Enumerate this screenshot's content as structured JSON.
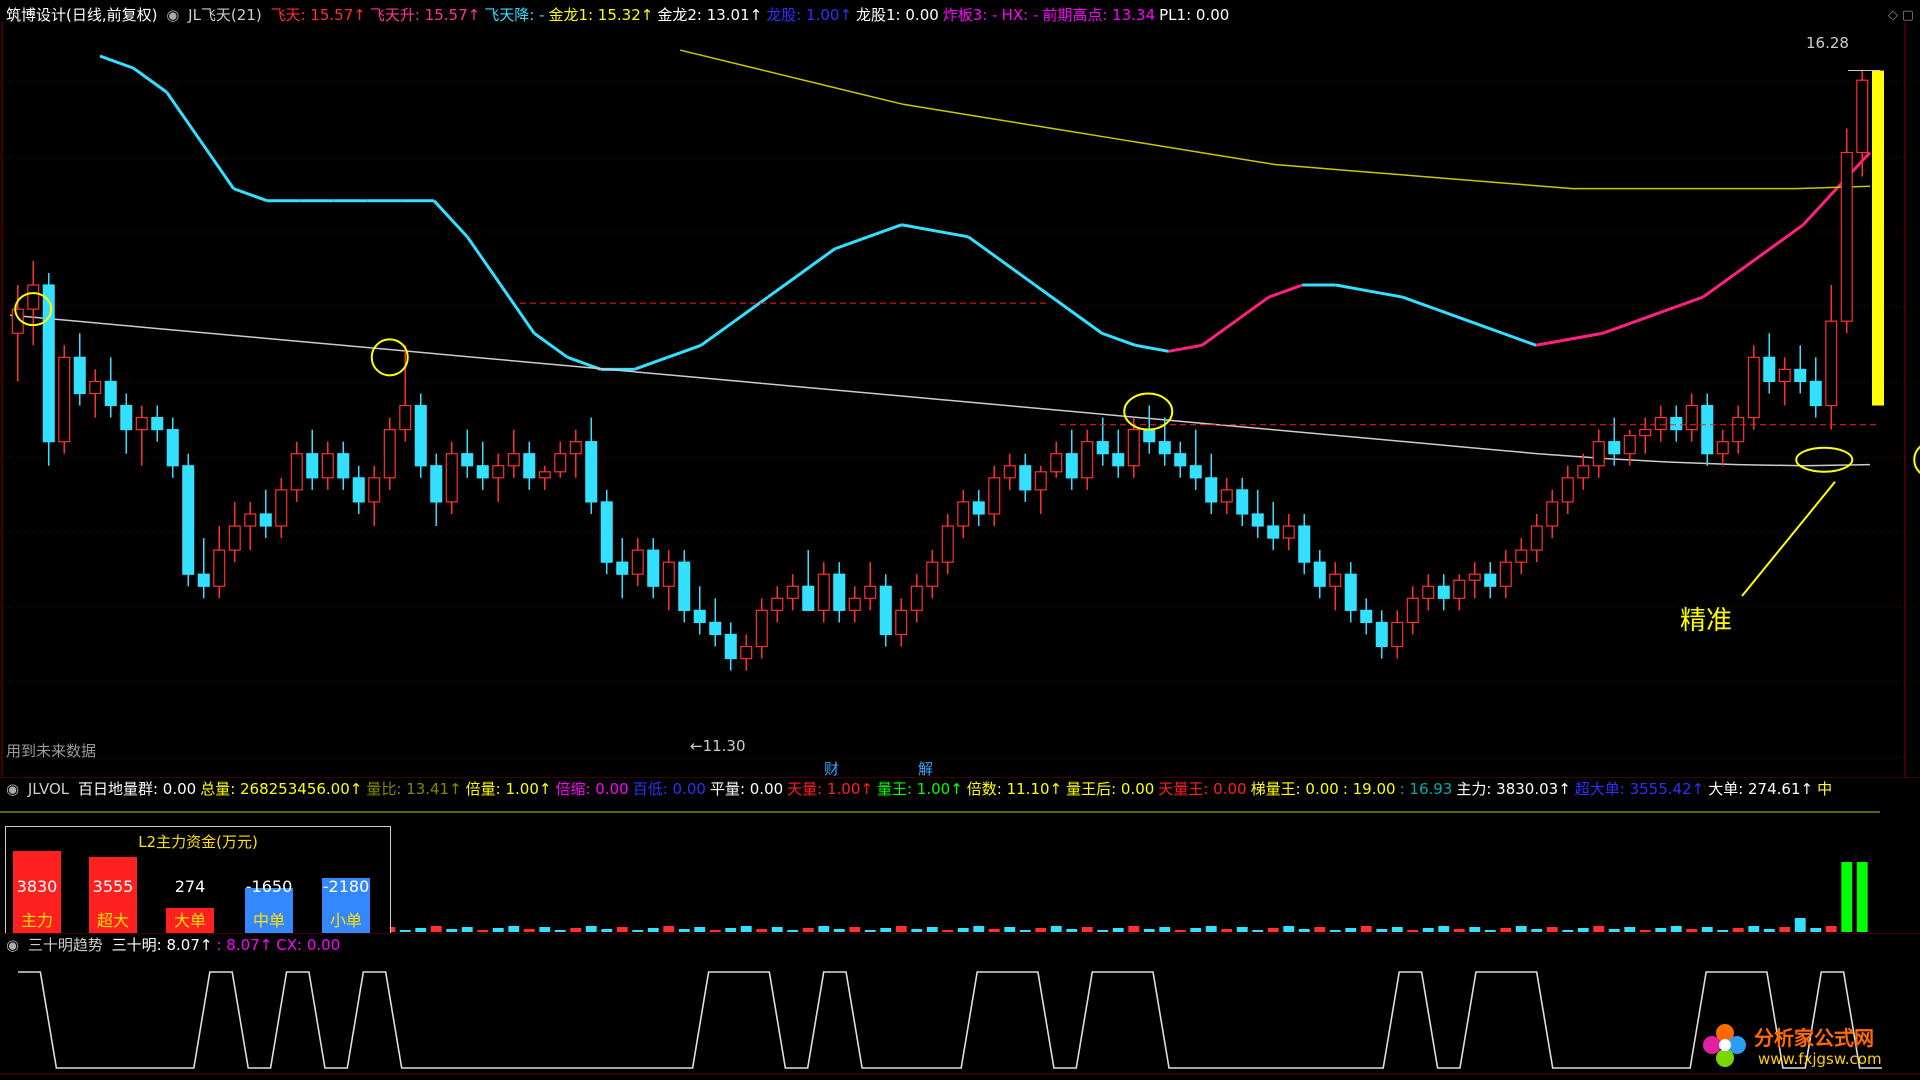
{
  "main_info": {
    "title": "筑博设计(日线,前复权)",
    "indicator": "JL飞天(21)",
    "items": [
      {
        "label": "飞天:",
        "value": "15.57",
        "arrow": "↑",
        "color": "#ff3030"
      },
      {
        "label": "飞天升:",
        "value": "15.57",
        "arrow": "↑",
        "color": "#ff3399"
      },
      {
        "label": "飞天降:",
        "value": "-",
        "arrow": "",
        "color": "#33e0ff"
      },
      {
        "label": "金龙1:",
        "value": "15.32",
        "arrow": "↑",
        "color": "#ffff00"
      },
      {
        "label": "金龙2:",
        "value": "13.01",
        "arrow": "↑",
        "color": "#ffffff"
      },
      {
        "label": "龙股:",
        "value": "1.00",
        "arrow": "↑",
        "color": "#3030ff"
      },
      {
        "label": "龙股1:",
        "value": "0.00",
        "arrow": "",
        "color": "#ffffff"
      },
      {
        "label": "炸板3:",
        "value": "-",
        "arrow": "",
        "color": "#ff00ff"
      },
      {
        "label": "HX:",
        "value": "-",
        "arrow": "",
        "color": "#ff00ff"
      },
      {
        "label": "前期高点:",
        "value": "13.34",
        "arrow": "",
        "color": "#ff00ff"
      },
      {
        "label": "PL1:",
        "value": "0.00",
        "arrow": "",
        "color": "#ffffff"
      }
    ],
    "bottom_left_note": "用到未来数据",
    "markers": [
      "财",
      "解"
    ],
    "annotation_text": "精准"
  },
  "vol_info": {
    "indicator": "JLVOL",
    "items": [
      {
        "label": "百日地量群:",
        "value": "0.00",
        "arrow": "",
        "color": "#ffffff"
      },
      {
        "label": "总量:",
        "value": "268253456.00",
        "arrow": "↑",
        "color": "#ffff00"
      },
      {
        "label": "量比:",
        "value": "13.41",
        "arrow": "↑",
        "color": "#888800"
      },
      {
        "label": "倍量:",
        "value": "1.00",
        "arrow": "↑",
        "color": "#ffff00"
      },
      {
        "label": "倍缩:",
        "value": "0.00",
        "arrow": "",
        "color": "#ff00ff"
      },
      {
        "label": "百低:",
        "value": "0.00",
        "arrow": "",
        "color": "#3030ff"
      },
      {
        "label": "平量:",
        "value": "0.00",
        "arrow": "",
        "color": "#ffffff"
      },
      {
        "label": "天量:",
        "value": "1.00",
        "arrow": "↑",
        "color": "#ff2020"
      },
      {
        "label": "量王:",
        "value": "1.00",
        "arrow": "↑",
        "color": "#00ff00"
      },
      {
        "label": "倍数:",
        "value": "11.10",
        "arrow": "↑",
        "color": "#ffff00"
      },
      {
        "label": "量王后:",
        "value": "0.00",
        "arrow": "",
        "color": "#ffff00"
      },
      {
        "label": "天量王:",
        "value": "0.00",
        "arrow": "",
        "color": "#ff2020"
      },
      {
        "label": "梯量王:",
        "value": "0.00",
        "arrow": "",
        "color": "#ffff00"
      },
      {
        "label": ":",
        "value": "19.00",
        "arrow": "",
        "color": "#ffff00"
      },
      {
        "label": ":",
        "value": "16.93",
        "arrow": "",
        "color": "#00aaaa"
      },
      {
        "label": "主力:",
        "value": "3830.03",
        "arrow": "↑",
        "color": "#ffffff"
      },
      {
        "label": "超大单:",
        "value": "3555.42",
        "arrow": "↑",
        "color": "#3030ff"
      },
      {
        "label": "大单:",
        "value": "274.61",
        "arrow": "↑",
        "color": "#ffffff"
      },
      {
        "label": "中",
        "value": "",
        "arrow": "",
        "color": "#ffff00"
      }
    ]
  },
  "l2_box": {
    "title": "L2主力资金(万元)",
    "bars": [
      {
        "name": "主力",
        "value": "3830",
        "color": "#ff2020",
        "level": 0.82
      },
      {
        "name": "超大",
        "value": "3555",
        "color": "#ff2020",
        "level": 0.76
      },
      {
        "name": "大单",
        "value": "274",
        "color": "#ff2020",
        "level": 0.25
      },
      {
        "name": "中单",
        "value": "-1650",
        "color": "#3388ff",
        "level": 0.45
      },
      {
        "name": "小单",
        "value": "-2180",
        "color": "#3388ff",
        "level": 0.55
      }
    ]
  },
  "osc_info": {
    "indicator": "三十明趋势",
    "items": [
      {
        "label": "三十明:",
        "value": "8.07",
        "arrow": "↑",
        "color": "#ffffff"
      },
      {
        "label": ":",
        "value": "8.07",
        "arrow": "↑",
        "color": "#ff00ff"
      },
      {
        "label": "CX:",
        "value": "0.00",
        "arrow": "",
        "color": "#ff00ff"
      }
    ]
  },
  "watermark": {
    "line1": "分析家公式网",
    "line2": "www.fxjgsw.com"
  },
  "chart_data": {
    "type": "candlestick",
    "ylim": [
      10.5,
      16.6
    ],
    "labels": {
      "high": "16.28",
      "low": "11.30"
    },
    "candles": [
      [
        14.1,
        14.5,
        13.7,
        14.3
      ],
      [
        14.3,
        14.7,
        14.0,
        14.5
      ],
      [
        14.5,
        14.6,
        13.0,
        13.2
      ],
      [
        13.2,
        14.0,
        13.1,
        13.9
      ],
      [
        13.9,
        14.1,
        13.5,
        13.6
      ],
      [
        13.6,
        13.8,
        13.4,
        13.7
      ],
      [
        13.7,
        13.9,
        13.4,
        13.5
      ],
      [
        13.5,
        13.6,
        13.1,
        13.3
      ],
      [
        13.3,
        13.5,
        13.0,
        13.4
      ],
      [
        13.4,
        13.5,
        13.2,
        13.3
      ],
      [
        13.3,
        13.4,
        12.9,
        13.0
      ],
      [
        13.0,
        13.1,
        12.0,
        12.1
      ],
      [
        12.1,
        12.4,
        11.9,
        12.0
      ],
      [
        12.0,
        12.5,
        11.9,
        12.3
      ],
      [
        12.3,
        12.7,
        12.2,
        12.5
      ],
      [
        12.5,
        12.7,
        12.3,
        12.6
      ],
      [
        12.6,
        12.8,
        12.4,
        12.5
      ],
      [
        12.5,
        12.9,
        12.4,
        12.8
      ],
      [
        12.8,
        13.2,
        12.7,
        13.1
      ],
      [
        13.1,
        13.3,
        12.8,
        12.9
      ],
      [
        12.9,
        13.2,
        12.8,
        13.1
      ],
      [
        13.1,
        13.2,
        12.8,
        12.9
      ],
      [
        12.9,
        13.0,
        12.6,
        12.7
      ],
      [
        12.7,
        13.0,
        12.5,
        12.9
      ],
      [
        12.9,
        13.4,
        12.8,
        13.3
      ],
      [
        13.3,
        14.0,
        13.2,
        13.5
      ],
      [
        13.5,
        13.6,
        12.9,
        13.0
      ],
      [
        13.0,
        13.1,
        12.5,
        12.7
      ],
      [
        12.7,
        13.2,
        12.6,
        13.1
      ],
      [
        13.1,
        13.3,
        12.9,
        13.0
      ],
      [
        13.0,
        13.2,
        12.8,
        12.9
      ],
      [
        12.9,
        13.1,
        12.7,
        13.0
      ],
      [
        13.0,
        13.3,
        12.9,
        13.1
      ],
      [
        13.1,
        13.2,
        12.8,
        12.9
      ],
      [
        12.9,
        13.0,
        12.8,
        12.95
      ],
      [
        12.95,
        13.2,
        12.9,
        13.1
      ],
      [
        13.1,
        13.3,
        12.9,
        13.2
      ],
      [
        13.2,
        13.4,
        12.6,
        12.7
      ],
      [
        12.7,
        12.8,
        12.1,
        12.2
      ],
      [
        12.2,
        12.4,
        11.9,
        12.1
      ],
      [
        12.1,
        12.4,
        12.0,
        12.3
      ],
      [
        12.3,
        12.4,
        11.9,
        12.0
      ],
      [
        12.0,
        12.3,
        11.8,
        12.2
      ],
      [
        12.2,
        12.3,
        11.7,
        11.8
      ],
      [
        11.8,
        12.0,
        11.6,
        11.7
      ],
      [
        11.7,
        11.9,
        11.5,
        11.6
      ],
      [
        11.6,
        11.7,
        11.3,
        11.4
      ],
      [
        11.4,
        11.6,
        11.3,
        11.5
      ],
      [
        11.5,
        11.9,
        11.4,
        11.8
      ],
      [
        11.8,
        12.0,
        11.7,
        11.9
      ],
      [
        11.9,
        12.1,
        11.8,
        12.0
      ],
      [
        12.0,
        12.3,
        11.9,
        11.8
      ],
      [
        11.8,
        12.2,
        11.7,
        12.1
      ],
      [
        12.1,
        12.2,
        11.7,
        11.8
      ],
      [
        11.8,
        12.0,
        11.7,
        11.9
      ],
      [
        11.9,
        12.2,
        11.8,
        12.0
      ],
      [
        12.0,
        12.1,
        11.5,
        11.6
      ],
      [
        11.6,
        11.9,
        11.5,
        11.8
      ],
      [
        11.8,
        12.1,
        11.7,
        12.0
      ],
      [
        12.0,
        12.3,
        11.9,
        12.2
      ],
      [
        12.2,
        12.6,
        12.1,
        12.5
      ],
      [
        12.5,
        12.8,
        12.4,
        12.7
      ],
      [
        12.7,
        12.8,
        12.5,
        12.6
      ],
      [
        12.6,
        13.0,
        12.5,
        12.9
      ],
      [
        12.9,
        13.1,
        12.8,
        13.0
      ],
      [
        13.0,
        13.1,
        12.7,
        12.8
      ],
      [
        12.8,
        13.0,
        12.6,
        12.95
      ],
      [
        12.95,
        13.2,
        12.9,
        13.1
      ],
      [
        13.1,
        13.3,
        12.8,
        12.9
      ],
      [
        12.9,
        13.3,
        12.8,
        13.2
      ],
      [
        13.2,
        13.4,
        13.0,
        13.1
      ],
      [
        13.1,
        13.3,
        12.9,
        13.0
      ],
      [
        13.0,
        13.4,
        12.9,
        13.3
      ],
      [
        13.3,
        13.5,
        13.1,
        13.2
      ],
      [
        13.2,
        13.4,
        13.0,
        13.1
      ],
      [
        13.1,
        13.2,
        12.9,
        13.0
      ],
      [
        13.0,
        13.3,
        12.8,
        12.9
      ],
      [
        12.9,
        13.1,
        12.6,
        12.7
      ],
      [
        12.7,
        12.9,
        12.6,
        12.8
      ],
      [
        12.8,
        12.9,
        12.5,
        12.6
      ],
      [
        12.6,
        12.8,
        12.4,
        12.5
      ],
      [
        12.5,
        12.7,
        12.3,
        12.4
      ],
      [
        12.4,
        12.6,
        12.3,
        12.5
      ],
      [
        12.5,
        12.6,
        12.1,
        12.2
      ],
      [
        12.2,
        12.3,
        11.9,
        12.0
      ],
      [
        12.0,
        12.2,
        11.8,
        12.1
      ],
      [
        12.1,
        12.2,
        11.7,
        11.8
      ],
      [
        11.8,
        11.9,
        11.6,
        11.7
      ],
      [
        11.7,
        11.8,
        11.4,
        11.5
      ],
      [
        11.5,
        11.8,
        11.4,
        11.7
      ],
      [
        11.7,
        12.0,
        11.6,
        11.9
      ],
      [
        11.9,
        12.1,
        11.8,
        12.0
      ],
      [
        12.0,
        12.1,
        11.8,
        11.9
      ],
      [
        11.9,
        12.1,
        11.8,
        12.05
      ],
      [
        12.05,
        12.2,
        11.9,
        12.1
      ],
      [
        12.1,
        12.2,
        11.9,
        12.0
      ],
      [
        12.0,
        12.3,
        11.9,
        12.2
      ],
      [
        12.2,
        12.4,
        12.1,
        12.3
      ],
      [
        12.3,
        12.6,
        12.2,
        12.5
      ],
      [
        12.5,
        12.8,
        12.4,
        12.7
      ],
      [
        12.7,
        13.0,
        12.6,
        12.9
      ],
      [
        12.9,
        13.1,
        12.8,
        13.0
      ],
      [
        13.0,
        13.3,
        12.9,
        13.2
      ],
      [
        13.2,
        13.4,
        13.0,
        13.1
      ],
      [
        13.1,
        13.3,
        13.0,
        13.25
      ],
      [
        13.25,
        13.4,
        13.1,
        13.3
      ],
      [
        13.3,
        13.5,
        13.2,
        13.4
      ],
      [
        13.4,
        13.5,
        13.2,
        13.3
      ],
      [
        13.3,
        13.6,
        13.2,
        13.5
      ],
      [
        13.5,
        13.6,
        13.0,
        13.1
      ],
      [
        13.1,
        13.3,
        13.0,
        13.2
      ],
      [
        13.2,
        13.5,
        13.1,
        13.4
      ],
      [
        13.4,
        14.0,
        13.3,
        13.9
      ],
      [
        13.9,
        14.1,
        13.6,
        13.7
      ],
      [
        13.7,
        13.9,
        13.5,
        13.8
      ],
      [
        13.8,
        14.0,
        13.6,
        13.7
      ],
      [
        13.7,
        13.9,
        13.4,
        13.5
      ],
      [
        13.5,
        14.5,
        13.3,
        14.2
      ],
      [
        14.2,
        15.8,
        14.1,
        15.6
      ],
      [
        15.6,
        16.28,
        15.4,
        16.2
      ]
    ],
    "series": [
      {
        "values": [
          16.4,
          16.3,
          16.1,
          15.7,
          15.3,
          15.2,
          15.2,
          15.2,
          15.2,
          15.2,
          15.2,
          14.9,
          14.5,
          14.1,
          13.9,
          13.8,
          13.8,
          13.9,
          14.0,
          14.2,
          14.4,
          14.6,
          14.8,
          14.9,
          15.0,
          14.95,
          14.9,
          14.7,
          14.5,
          14.3,
          14.1,
          14.0,
          13.95,
          14.0,
          14.2,
          14.4,
          14.5,
          14.5,
          14.45,
          14.4,
          14.3,
          14.2,
          14.1,
          14.0,
          14.05,
          14.1,
          14.2,
          14.3,
          14.4,
          14.6,
          14.8,
          15.0,
          15.3,
          15.6
        ],
        "color": "#33e0ff",
        "alt_color": "#ff2080"
      },
      {
        "values": [
          16.45,
          16.3,
          16.15,
          16.0,
          15.9,
          15.8,
          15.7,
          15.6,
          15.5,
          15.45,
          15.4,
          15.35,
          15.3,
          15.3,
          15.3,
          15.3,
          15.32
        ],
        "color": "#c8c800"
      },
      {
        "values": [
          14.25,
          14.2,
          14.15,
          14.1,
          14.05,
          14.0,
          13.95,
          13.9,
          13.85,
          13.8,
          13.75,
          13.7,
          13.65,
          13.6,
          13.55,
          13.5,
          13.45,
          13.4,
          13.35,
          13.3,
          13.25,
          13.2,
          13.15,
          13.1,
          13.06,
          13.03,
          13.01,
          13.0,
          13.01
        ],
        "color": "#cccccc"
      }
    ]
  }
}
